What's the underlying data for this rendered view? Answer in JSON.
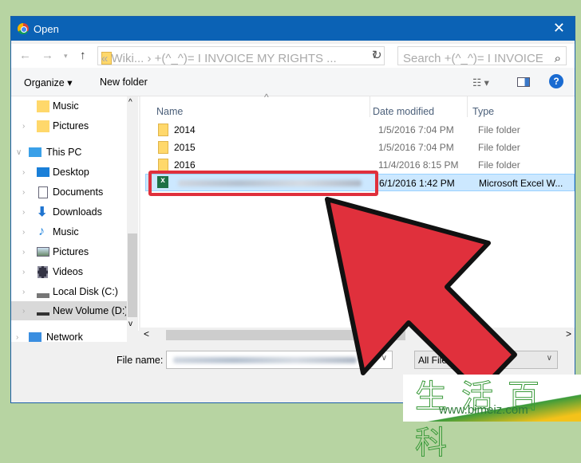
{
  "title": "Open",
  "address": {
    "path": "«  Wiki...  ›  +(^_^)= I INVOICE MY RIGHTS ...",
    "search_placeholder": "Search +(^_^)= I INVOICE MY..."
  },
  "toolbar": {
    "organize": "Organize ▾",
    "new_folder": "New folder"
  },
  "sidebar": [
    {
      "label": "Music",
      "icon": "folder-icon"
    },
    {
      "label": "Pictures",
      "icon": "folder-icon"
    },
    {
      "label": "This PC",
      "icon": "computer-icon"
    },
    {
      "label": "Desktop",
      "icon": "desktop-icon"
    },
    {
      "label": "Documents",
      "icon": "documents-icon"
    },
    {
      "label": "Downloads",
      "icon": "download-icon"
    },
    {
      "label": "Music",
      "icon": "music-icon"
    },
    {
      "label": "Pictures",
      "icon": "pictures-icon"
    },
    {
      "label": "Videos",
      "icon": "videos-icon"
    },
    {
      "label": "Local Disk (C:)",
      "icon": "disk-icon"
    },
    {
      "label": "New Volume (D:)",
      "icon": "drive-icon"
    },
    {
      "label": "Network",
      "icon": "network-icon"
    }
  ],
  "columns": {
    "name": "Name",
    "date": "Date modified",
    "type": "Type"
  },
  "files": [
    {
      "name": "2014",
      "date": "1/5/2016 7:04 PM",
      "type": "File folder"
    },
    {
      "name": "2015",
      "date": "1/5/2016 7:04 PM",
      "type": "File folder"
    },
    {
      "name": "2016",
      "date": "11/4/2016 8:15 PM",
      "type": "File folder"
    },
    {
      "name": "",
      "date": "6/1/2016 1:42 PM",
      "type": "Microsoft Excel W..."
    }
  ],
  "bottom": {
    "file_name_label": "File name:",
    "file_type": "All Files"
  },
  "watermark": {
    "text": "生活百科",
    "url": "www.bimeiz.com"
  },
  "colors": {
    "titlebar": "#0b62b5",
    "highlight": "#e0303c",
    "selection": "#cce8ff"
  }
}
